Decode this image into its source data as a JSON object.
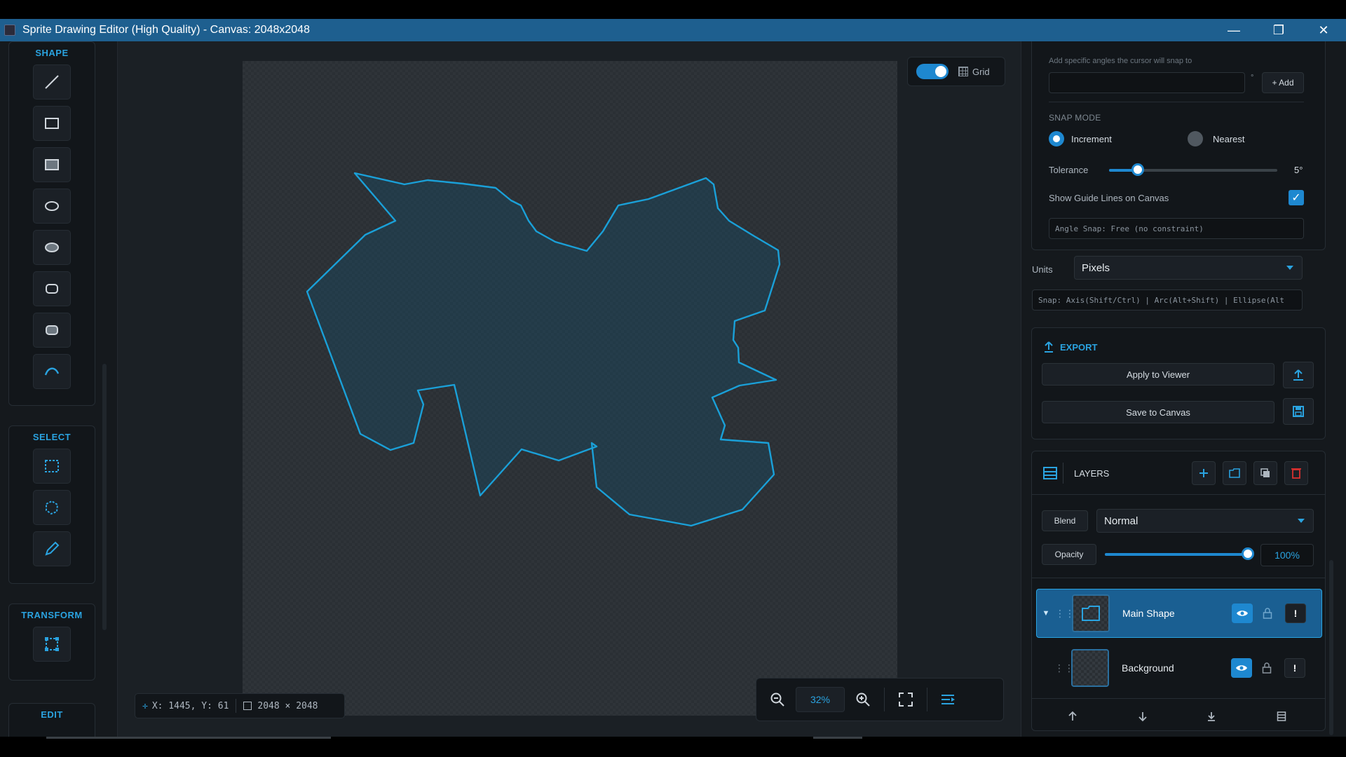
{
  "window": {
    "title": "Sprite Drawing Editor (High Quality) - Canvas: 2048x2048",
    "minimize_glyph": "—",
    "restore_glyph": "❐",
    "close_glyph": "✕"
  },
  "toolbar": {
    "shape_title": "SHAPE",
    "shape_tools": [
      "line-tool",
      "rectangle-outline-tool",
      "rectangle-filled-tool",
      "ellipse-outline-tool",
      "ellipse-filled-tool",
      "rounded-rect-outline-tool",
      "rounded-rect-filled-tool",
      "curve-tool"
    ],
    "select_title": "SELECT",
    "select_tools": [
      "rect-select-tool",
      "lasso-select-tool",
      "pen-select-tool"
    ],
    "transform_title": "TRANSFORM",
    "edit_title": "EDIT"
  },
  "canvas": {
    "grid_label": "Grid",
    "grid_enabled": true,
    "coords": "X: 1445, Y: 61",
    "size": "2048 × 2048",
    "zoom": "32%",
    "shape_color": "#1aa0d8"
  },
  "snap": {
    "angles_hint": "Add specific angles the cursor will snap to",
    "angle_input_value": "",
    "degree_symbol": "°",
    "add_label": "+ Add",
    "mode_title": "SNAP MODE",
    "mode_increment": "Increment",
    "mode_nearest": "Nearest",
    "selected_mode": "Increment",
    "tolerance_label": "Tolerance",
    "tolerance_value": "5°",
    "tolerance_fraction": 0.17,
    "guide_label": "Show Guide Lines on Canvas",
    "guide_checked": true,
    "guide_check_glyph": "✓",
    "status": "Angle Snap: Free (no constraint)",
    "units_label": "Units",
    "units_value": "Pixels",
    "shortcuts": "Snap: Axis(Shift/Ctrl) | Arc(Alt+Shift) | Ellipse(Alt"
  },
  "export": {
    "title": "EXPORT",
    "apply_label": "Apply to Viewer",
    "save_label": "Save to Canvas"
  },
  "layers": {
    "title": "LAYERS",
    "blend_label": "Blend",
    "blend_value": "Normal",
    "opacity_label": "Opacity",
    "opacity_value": "100%",
    "opacity_fraction": 1.0,
    "items": [
      {
        "name": "Main Shape",
        "selected": true,
        "expanded_glyph": "▼",
        "menu_glyph": "!"
      },
      {
        "name": "Background",
        "selected": false,
        "menu_glyph": "!"
      }
    ]
  },
  "colors": {
    "accent": "#1e88d0",
    "selected_row": "#1a5f92",
    "delete": "#d9302f"
  }
}
